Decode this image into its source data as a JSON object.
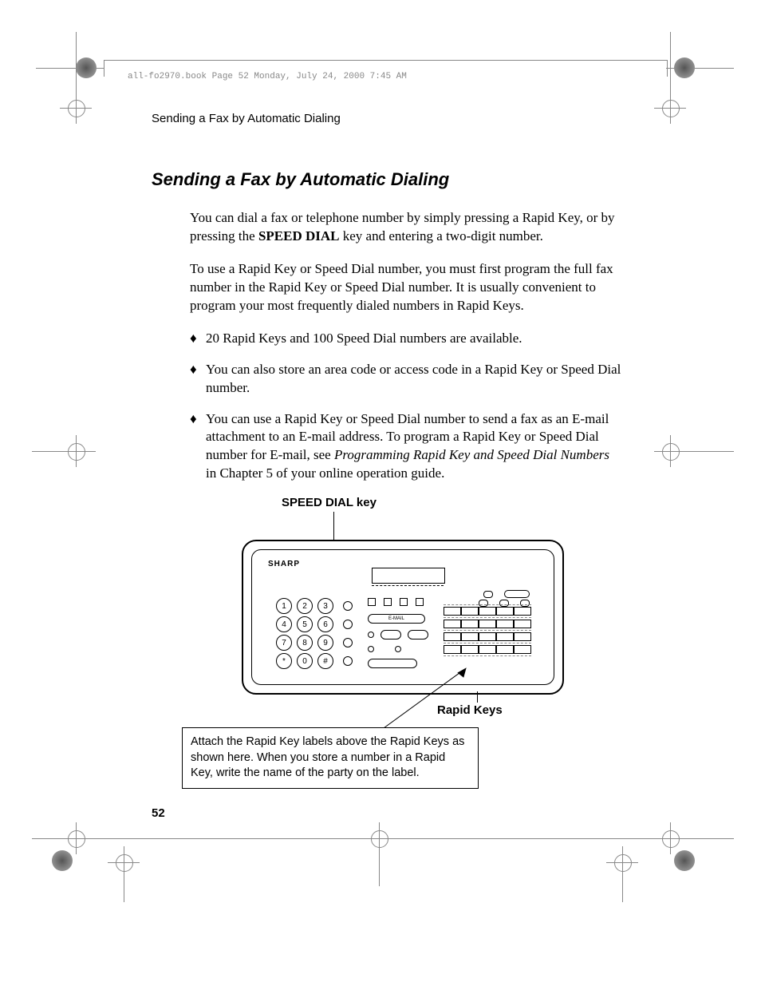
{
  "header_line": "all-fo2970.book  Page 52  Monday, July 24, 2000  7:45 AM",
  "running_head": "Sending a Fax by Automatic Dialing",
  "title": "Sending a Fax by Automatic Dialing",
  "para1_a": "You can dial a fax or telephone number by simply pressing a Rapid Key, or by pressing the ",
  "para1_bold": "SPEED DIAL",
  "para1_b": " key and entering a two-digit number.",
  "para2": "To use a Rapid Key or Speed Dial number, you must first program the full fax number in the Rapid Key or Speed Dial number. It is usually convenient to program your most frequently dialed numbers in Rapid Keys.",
  "bullets": {
    "b1": "20 Rapid Keys and 100 Speed Dial numbers are available.",
    "b2": "You can also store an area code or access code in a Rapid Key or Speed Dial number.",
    "b3_a": "You can use a Rapid Key or Speed Dial number to send a fax as an E-mail attachment to an E-mail address. To program a Rapid Key or Speed Dial number for E-mail, see ",
    "b3_i": "Programming Rapid Key and Speed Dial Numbers",
    "b3_b": " in Chapter 5 of your online operation guide."
  },
  "fig": {
    "speed_dial_label": "SPEED DIAL key",
    "rapid_keys_label": "Rapid Keys",
    "brand": "SHARP",
    "email_label": "E-MAIL",
    "keypad": [
      [
        "1",
        "2",
        "3"
      ],
      [
        "4",
        "5",
        "6"
      ],
      [
        "7",
        "8",
        "9"
      ],
      [
        "*",
        "0",
        "#"
      ]
    ],
    "caption": "Attach the Rapid Key labels above the Rapid Keys as shown here. When you store a number in a Rapid Key, write the name of the party on the label."
  },
  "page_number": "52",
  "marker": "♦"
}
